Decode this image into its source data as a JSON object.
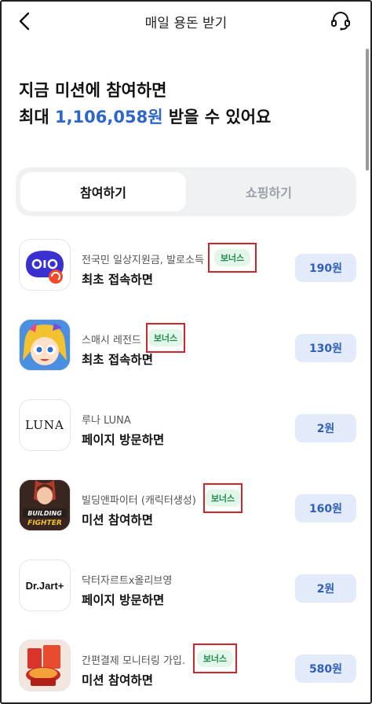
{
  "header": {
    "title": "매일 용돈 받기",
    "back_icon": "chevron-left-icon",
    "support_icon": "headset-icon"
  },
  "hero": {
    "line1": "지금 미션에 참여하면",
    "line2_prefix": "최대 ",
    "line2_amount": "1,106,058원",
    "line2_suffix": " 받을 수 있어요",
    "amount_color": "#2f66c9"
  },
  "tabs": [
    {
      "label": "참여하기",
      "active": true
    },
    {
      "label": "쇼핑하기",
      "active": false
    }
  ],
  "missions": [
    {
      "subtitle": "전국민 일상지원금, 발로소득",
      "title": "최초 접속하면",
      "bonus": "보너스",
      "reward": "190원",
      "icon": "balo-app-icon"
    },
    {
      "subtitle": "스매시 레전드",
      "title": "최초 접속하면",
      "bonus": "보너스",
      "reward": "130원",
      "icon": "smash-legends-app-icon"
    },
    {
      "subtitle": "루나 LUNA",
      "title": "페이지 방문하면",
      "bonus": "",
      "reward": "2원",
      "icon": "luna-app-icon",
      "icon_text": "LUNA"
    },
    {
      "subtitle": "빌딩앤파이터 (캐릭터생성)",
      "title": "미션 참여하면",
      "bonus": "보너스",
      "reward": "160원",
      "icon": "building-fighter-app-icon"
    },
    {
      "subtitle": "닥터자르트x올리브영",
      "title": "페이지 방문하면",
      "bonus": "",
      "reward": "2원",
      "icon": "drjart-app-icon",
      "icon_text": "Dr.Jart+"
    },
    {
      "subtitle": "간편결제 모니터링 가입.",
      "title": "미션 참여하면",
      "bonus": "보너스",
      "reward": "580원",
      "icon": "payment-monitoring-app-icon"
    }
  ]
}
